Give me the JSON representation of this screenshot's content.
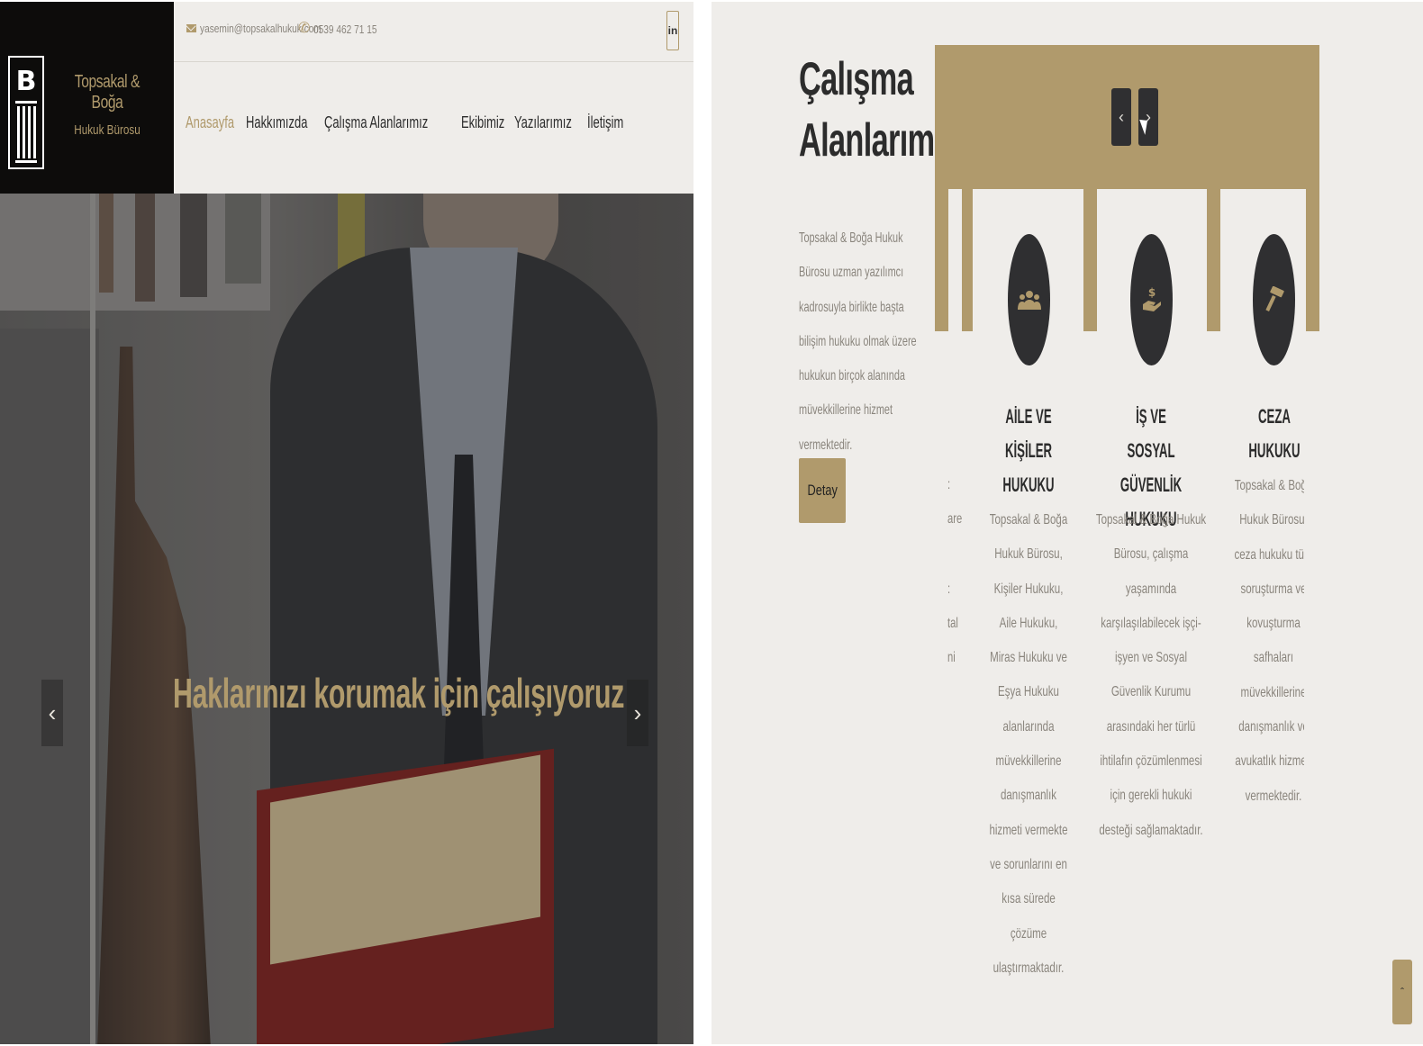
{
  "brand": {
    "title": "Topsakal & Boğa",
    "subtitle": "Hukuk Bürosu",
    "accent": "#b09a6c",
    "dark": "#0d0c0b"
  },
  "topbar": {
    "email": "yasemin@topsakalhukuk.com",
    "phone": "0539 462 71 15",
    "social": "in"
  },
  "nav": {
    "items": [
      "Anasayfa",
      "Hakkımızda",
      "Çalışma Alanlarımız",
      "Ekibimiz",
      "Yazılarımız",
      "İletişim"
    ],
    "active": "Anasayfa"
  },
  "hero": {
    "headline": "Haklarınızı korumak için çalışıyoruz",
    "prev": "‹",
    "next": "›"
  },
  "practice": {
    "title_line1": "Çalışma",
    "title_line2": "Alanlarımız",
    "description": "Topsakal & Boğa Hukuk Bürosu uzman yazılımcı kadrosuyla birlikte başta bilişim hukuku olmak üzere hukukun birçok alanında müvekkillerine hizmet vermektedir.",
    "button": "Detay",
    "carousel_prev": "‹",
    "carousel_next": "›",
    "fragments": [
      ":",
      "are",
      ":",
      "tal",
      "ni"
    ],
    "cards": [
      {
        "icon": "people-icon",
        "title": "AİLE VE KİŞİLER HUKUKU",
        "text": "Topsakal & Boğa Hukuk Bürosu, Kişiler Hukuku, Aile Hukuku, Miras Hukuku ve Eşya Hukuku alanlarında müvekkillerine danışmanlık hizmeti vermekte ve sorunlarını en kısa sürede çözüme ulaştırmaktadır."
      },
      {
        "icon": "money-hand-icon",
        "title": "İŞ VE SOSYAL GÜVENLİK HUKUKU",
        "text": "Topsakal & Boğa Hukuk Bürosu, çalışma yaşamında karşılaşılabilecek işçi-işyen ve Sosyal Güvenlik Kurumu arasındaki her türlü ihtilafın çözümlenmesi için gerekli hukuki desteği sağlamaktadır."
      },
      {
        "icon": "gavel-icon",
        "title": "CEZA HUKUKU",
        "text": "Topsakal & Boğa Hukuk Bürosu, ceza hukuku tüm soruşturma ve kovuşturma safhaları müvekkillerine danışmanlık ve avukatlık hizmeti vermektedir."
      }
    ]
  },
  "scroll_top": "ˆ"
}
